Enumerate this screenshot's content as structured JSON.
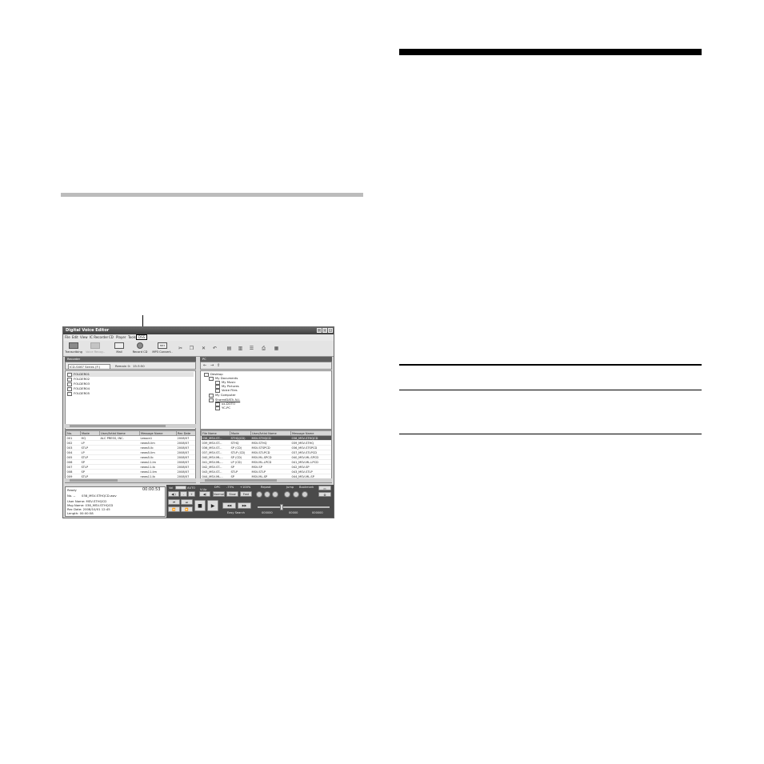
{
  "app": {
    "title": "Digital Voice Editor",
    "window_buttons": [
      "_",
      "□",
      "×"
    ]
  },
  "menu": {
    "file": "File",
    "edit": "Edit",
    "view": "View",
    "ic_recorder": "IC Recorder",
    "cd": "CD",
    "player": "Player",
    "tools": "Tools",
    "dss": "DSS"
  },
  "toolbar": {
    "transcribing": "Transcribing",
    "voice_recog": "Voice Recog..",
    "mail": "Mail",
    "record_cd": "Record CD",
    "mp3_convert": "MP3 Convert..",
    "mp3_icon_text": "MP3"
  },
  "left_pane": {
    "header": "Recorder",
    "device": "ICD-SX67 Series (F:)",
    "remain": "Remain 0:",
    "remain_value": "15:3:50",
    "folders": [
      "FOLDER01",
      "FOLDER02",
      "FOLDER03",
      "FOLDER04",
      "FOLDER05"
    ],
    "columns": [
      "No.",
      "Mode",
      "User/Artist Name",
      "Message Name",
      "Rec Date"
    ],
    "rows": [
      [
        "001",
        "HQ",
        "ALC PRESS, INC.",
        "Lesson1",
        "2008/07"
      ],
      [
        "002",
        "LP",
        "",
        "news5.lim",
        "2008/07"
      ],
      [
        "003",
        "STLP",
        "",
        "news5.lb",
        "2008/07"
      ],
      [
        "004",
        "LP",
        "",
        "news5.lim",
        "2008/07"
      ],
      [
        "005",
        "STLP",
        "",
        "news5.lb",
        "2008/07"
      ],
      [
        "006",
        "SP",
        "",
        "news11.lm",
        "2008/07"
      ],
      [
        "007",
        "STLP",
        "",
        "news11.lb",
        "2008/07"
      ],
      [
        "008",
        "SP",
        "",
        "news11.lim",
        "2008/07"
      ],
      [
        "009",
        "STLP",
        "",
        "news11.lb",
        "2008/07"
      ]
    ]
  },
  "right_pane": {
    "header": "PC",
    "tree": [
      "Desktop",
      "My Documents",
      "My Music",
      "My Pictures",
      "Voice Files",
      "My Computer",
      "SharedDATA ALL",
      "xx-DOTO",
      "YC-PC"
    ],
    "columns": [
      "File Name",
      "Mode",
      "User/Artist Name",
      "Message Name"
    ],
    "rows": [
      [
        "038_MSV-ST...",
        "STHQ(CD)",
        "MSV-STHQCD",
        "038_MSV-STHQCD"
      ],
      [
        "039_MSV-ST...",
        "STHQ",
        "MSV-STHQ",
        "039_MSV-STHQ"
      ],
      [
        "036_MSV-ST...",
        "SP (CD)",
        "MSV-STSPCD",
        "036_MSV-STSPCD"
      ],
      [
        "037_MSV-ST...",
        "STLP (CD)",
        "MSV-STLPCD",
        "037_MSV-STLPCD"
      ],
      [
        "040_MSV-ML...",
        "SP (CD)",
        "MSV-ML-SPCD",
        "040_MSV-ML-SPCD"
      ],
      [
        "041_MSV-ML...",
        "LP (CD)",
        "MSV-ML-LPCD",
        "041_MSV-ML-LPCD"
      ],
      [
        "042_MSV-ST...",
        "SP",
        "MSV-SP",
        "042_MSV-SP"
      ],
      [
        "043_MSV-ST...",
        "STLP",
        "MSV-STLP",
        "043_MSV-STLP"
      ],
      [
        "044_MSV-ML...",
        "SP",
        "MSV-ML-SP",
        "044_MSV-ML-SP"
      ]
    ]
  },
  "status": {
    "state": "Ready",
    "counter": "00:00:53",
    "no": "No. --",
    "file": "038_MSV-STHQCD.wav",
    "user": "User Name: MSV-STHQCD",
    "msg": "Msg Name: 038_MSV-STHQCD",
    "rec_date": "Rec Date: 2008/10/01 12:45",
    "length": "Length: 00:00:58"
  },
  "controls": {
    "vol": "Vol",
    "auto": "AUTO",
    "vtap": "V-Up",
    "dpc": "DPC",
    "minus75": "-75%",
    "plus100": "+100%",
    "normal": "Normal",
    "slow": "Slow",
    "fast": "Fast",
    "repeat": "Repeat",
    "jump": "Jump",
    "bookmark": "Bookmark",
    "easy_search": "Easy Search",
    "scale": [
      "000000",
      "00000",
      "000000"
    ]
  }
}
